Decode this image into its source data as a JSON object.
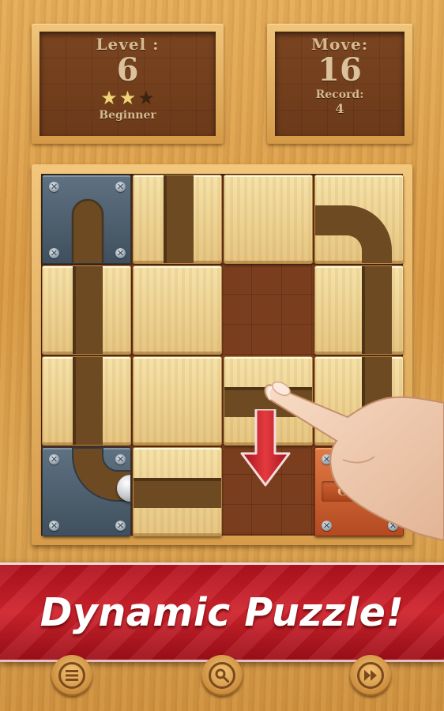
{
  "level_panel": {
    "label": "Level :",
    "value": "6",
    "stars_earned": 2,
    "stars_total": 3,
    "difficulty": "Beginner"
  },
  "move_panel": {
    "label": "Move:",
    "value": "16",
    "record_label": "Record:",
    "record_value": "4"
  },
  "board": {
    "goal_label": "GOAL!",
    "move_hint_direction": "down"
  },
  "banner": {
    "text": "Dynamic Puzzle!"
  },
  "bottom_nav": {
    "menu_icon": "menu-icon",
    "hint_icon": "search-icon",
    "skip_icon": "fast-forward-icon"
  },
  "colors": {
    "banner_red": "#c81f2a",
    "board_frame": "#e0a853",
    "track_brown": "#6d4a22",
    "metal_tile": "#4f606f",
    "goal_tile": "#c85a2e"
  }
}
